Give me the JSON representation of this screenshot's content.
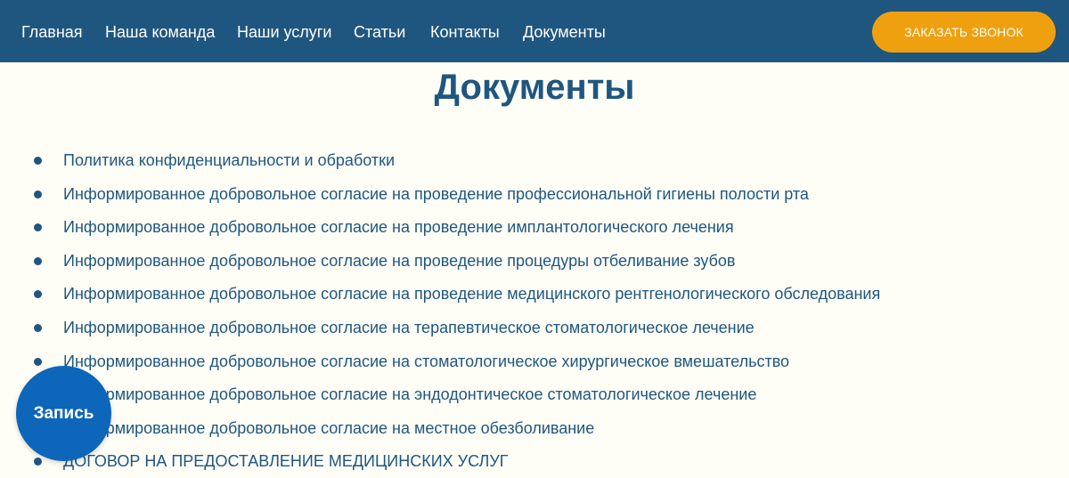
{
  "header": {
    "nav": [
      {
        "label": "Главная"
      },
      {
        "label": "Наша команда"
      },
      {
        "label": "Наши услуги"
      },
      {
        "label": "Статьи"
      },
      {
        "label": "Контакты"
      },
      {
        "label": "Документы"
      }
    ],
    "call_button_label": "ЗАКАЗАТЬ ЗВОНОК"
  },
  "main": {
    "title": "Документы",
    "documents": [
      {
        "label": "Политика конфиденциальности и обработки"
      },
      {
        "label": "Информированное добровольное согласие на проведение профессиональной гигиены полости рта"
      },
      {
        "label": "Информированное добровольное согласие на проведение имплантологического лечения"
      },
      {
        "label": "Информированное добровольное согласие на проведение процедуры отбеливание зубов"
      },
      {
        "label": "Информированное добровольное согласие на проведение медицинского рентгенологического обследования"
      },
      {
        "label": "Информированное добровольное согласие на терапевтическое стоматологическое лечение"
      },
      {
        "label": "Информированное добровольное согласие на стоматологическое хирургическое вмешательство"
      },
      {
        "label": "Информированное добровольное согласие на эндодонтическое стоматологическое лечение"
      },
      {
        "label": "Информированное добровольное согласие на местное обезболивание"
      },
      {
        "label": "ДОГОВОР НА ПРЕДОСТАВЛЕНИЕ МЕДИЦИНСКИХ УСЛУГ"
      }
    ]
  },
  "floating": {
    "record_label": "Запись"
  },
  "colors": {
    "header_bg": "#1f567f",
    "accent": "#efa00f",
    "record_button": "#0d66ba",
    "page_bg": "#fefef7"
  }
}
